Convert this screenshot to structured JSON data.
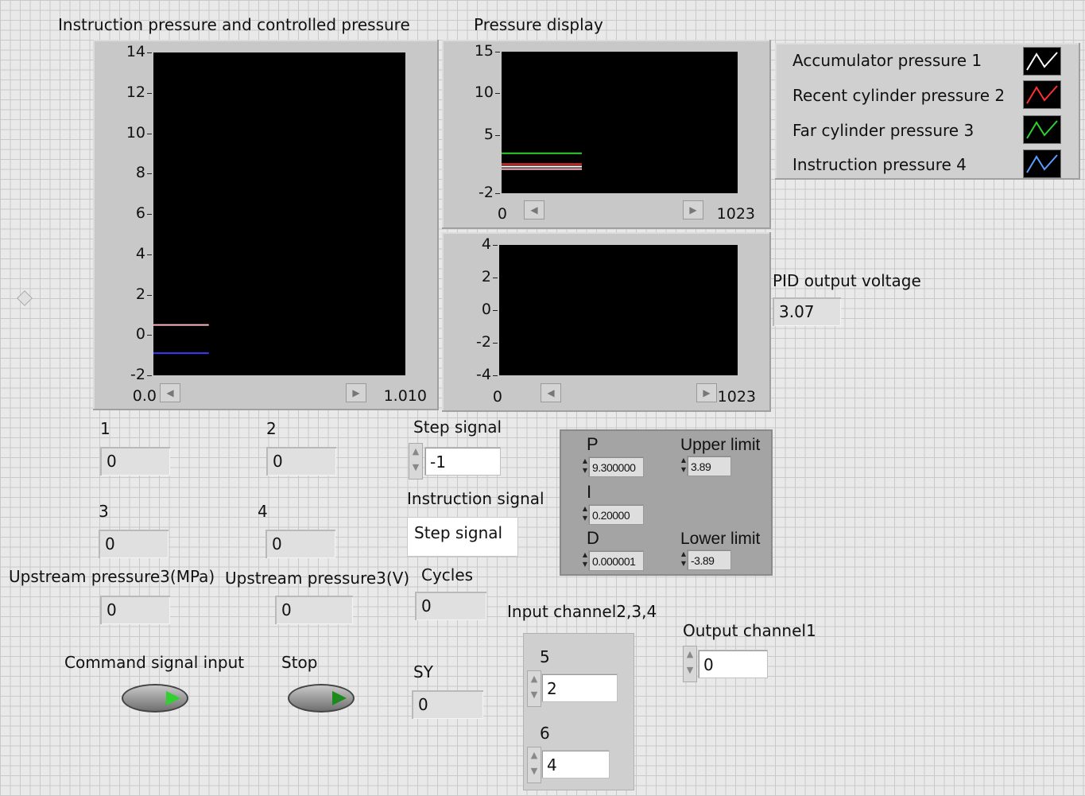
{
  "charts": {
    "left": {
      "title": "Instruction pressure and controlled pressure",
      "yticks": [
        "14",
        "12",
        "10",
        "8",
        "6",
        "4",
        "2",
        "0",
        "-2"
      ],
      "xmin": "0.0",
      "xmax": "1.010"
    },
    "right_top": {
      "title": "Pressure display",
      "yticks": [
        "15",
        "10",
        "5",
        "-2"
      ],
      "xmin": "0",
      "xmax": "1023"
    },
    "right_bottom": {
      "yticks": [
        "4",
        "2",
        "0",
        "-2",
        "-4"
      ],
      "xmin": "0",
      "xmax": "1023"
    }
  },
  "chart_data": [
    {
      "type": "line",
      "title": "Instruction pressure and controlled pressure",
      "ylim": [
        -2,
        14
      ],
      "x_range": [
        0.0,
        1.01
      ],
      "series": [
        {
          "color": "#ffb6c1",
          "values": [
            0.5,
            0.5
          ]
        },
        {
          "color": "#3a3aff",
          "values": [
            -0.9,
            -0.9
          ]
        }
      ]
    },
    {
      "type": "line",
      "title": "Pressure display",
      "ylim": [
        -2,
        15
      ],
      "x_range": [
        0,
        1023
      ],
      "series": [
        {
          "name": "Accumulator pressure 1",
          "color": "#ffffff",
          "values": [
            1.2,
            1.2
          ]
        },
        {
          "name": "Recent cylinder pressure 2",
          "color": "#ff3030",
          "values": [
            1.5,
            1.5
          ]
        },
        {
          "name": "Far cylinder pressure 3",
          "color": "#30d030",
          "values": [
            2.8,
            2.8
          ]
        },
        {
          "name": "Instruction pressure 4",
          "color": "#ffb6c1",
          "values": [
            0.9,
            0.9
          ]
        }
      ]
    },
    {
      "type": "line",
      "ylim": [
        -4,
        4
      ],
      "x_range": [
        0,
        1023
      ],
      "series": []
    }
  ],
  "legend": [
    {
      "label": "Accumulator pressure 1",
      "color": "#ffffff"
    },
    {
      "label": "Recent cylinder pressure 2",
      "color": "#ff3030"
    },
    {
      "label": "Far cylinder pressure 3",
      "color": "#30d030"
    },
    {
      "label": "Instruction pressure 4",
      "color": "#5aa0ff"
    }
  ],
  "pid_output": {
    "label": "PID output voltage",
    "value": "3.07"
  },
  "indicators": {
    "i1": {
      "label": "1",
      "value": "0"
    },
    "i2": {
      "label": "2",
      "value": "0"
    },
    "i3": {
      "label": "3",
      "value": "0"
    },
    "i4": {
      "label": "4",
      "value": "0"
    },
    "up_mpa": {
      "label": "Upstream pressure3(MPa)",
      "value": "0"
    },
    "up_v": {
      "label": "Upstream pressure3(V)",
      "value": "0"
    },
    "cycles": {
      "label": "Cycles",
      "value": "0"
    },
    "sy": {
      "label": "SY",
      "value": "0"
    }
  },
  "step_signal": {
    "label": "Step signal",
    "value": "-1"
  },
  "instruction_signal": {
    "label": "Instruction signal",
    "value": "Step signal"
  },
  "pid": {
    "p_label": "P",
    "p_value": "9.300000",
    "i_label": "I",
    "i_value": "0.20000",
    "d_label": "D",
    "d_value": "0.000001",
    "upper_label": "Upper limit",
    "upper_value": "3.89",
    "lower_label": "Lower limit",
    "lower_value": "-3.89"
  },
  "input_channels": {
    "label": "Input channel2,3,4",
    "c5_label": "5",
    "c5_value": "2",
    "c6_label": "6",
    "c6_value": "4"
  },
  "output_channel": {
    "label": "Output channel1",
    "value": "0"
  },
  "buttons": {
    "command_label": "Command signal input",
    "stop_label": "Stop"
  }
}
